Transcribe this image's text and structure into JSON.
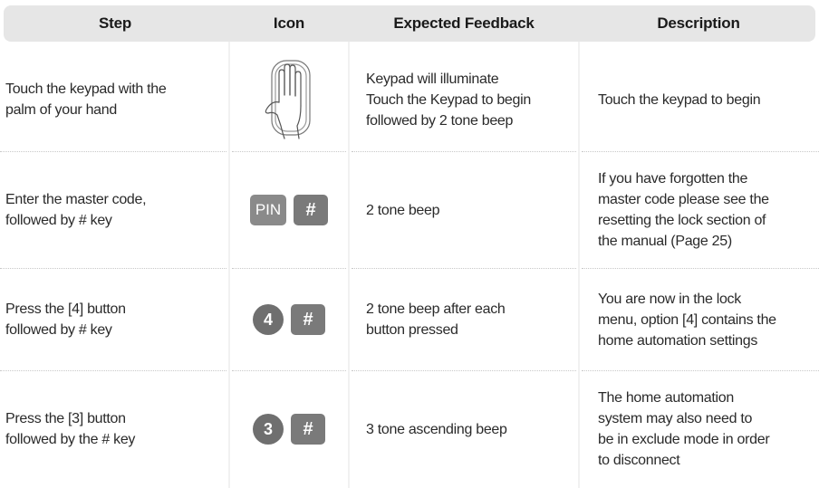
{
  "headers": {
    "step": "Step",
    "icon": "Icon",
    "feedback": "Expected Feedback",
    "description": "Description"
  },
  "rows": [
    {
      "step": "Touch the keypad with the\npalm of your hand",
      "icon": "palm-touch-icon",
      "feedback": "Keypad will illuminate\nTouch the Keypad to begin\nfollowed by 2 tone beep",
      "description": "Touch the keypad to begin"
    },
    {
      "step": "Enter the master code,\nfollowed by # key",
      "icon_keys": [
        "PIN",
        "#"
      ],
      "feedback": "2 tone beep",
      "description": "If you have forgotten the\nmaster code please see the\nresetting the lock section of\nthe manual (Page 25)"
    },
    {
      "step": "Press the [4] button\nfollowed by # key",
      "icon_keys": [
        "4",
        "#"
      ],
      "feedback": "2 tone beep after each\nbutton pressed",
      "description": "You are now in the lock\nmenu, option [4] contains the\nhome automation settings"
    },
    {
      "step": "Press the [3] button\nfollowed by the # key",
      "icon_keys": [
        "3",
        "#"
      ],
      "feedback": "3 tone ascending beep",
      "description": "The home automation\nsystem may also need to\nbe in exclude mode in order\nto disconnect"
    }
  ],
  "colors": {
    "header_bg": "#e6e6e6",
    "key_bg": "#7a7a7a",
    "text": "#2a2a2a"
  }
}
